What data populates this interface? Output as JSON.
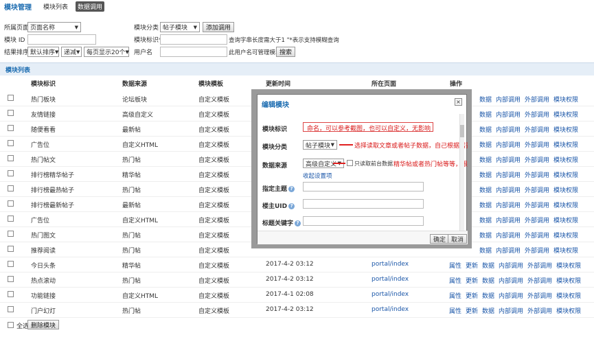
{
  "topbar": {
    "brand": "模块管理",
    "tabs": [
      "模块列表",
      "数据调用"
    ]
  },
  "filters": {
    "page_label": "所属页面",
    "page_value": "页面名称",
    "category_label": "模块分类",
    "category_value": "帖子模块",
    "add_call_button": "添加调用",
    "module_id_label": "模块 ID",
    "module_ident_label": "模块标识*",
    "ident_hint": "查询字串长度需大于1 \"*表示支持模糊查询",
    "sort_label": "结果排序",
    "sort_value": "默认排序",
    "order_value": "递减",
    "per_page_value": "每页显示20个",
    "username_label": "用户名",
    "username_hint": "此用户名可管理模块",
    "search_button": "搜索"
  },
  "list": {
    "title": "模块列表",
    "columns": [
      "模块标识",
      "数据来源",
      "模块模板",
      "更新时间",
      "所在页面",
      "操作"
    ],
    "ops_visible": [
      "数据",
      "内部调用",
      "外部调用",
      "模块权限"
    ],
    "ops_full": [
      "属性",
      "更新",
      "数据",
      "内部调用",
      "外部调用",
      "模块权限"
    ],
    "rows": [
      {
        "name": "热门板块",
        "source": "论坛板块",
        "template": "自定义模板",
        "time": "",
        "page": ""
      },
      {
        "name": "友情链接",
        "source": "高级自定义",
        "template": "自定义模板",
        "time": "",
        "page": ""
      },
      {
        "name": "随便看看",
        "source": "最新帖",
        "template": "自定义模板",
        "time": "",
        "page": ""
      },
      {
        "name": "广告位",
        "source": "自定义HTML",
        "template": "自定义模板",
        "time": "",
        "page": ""
      },
      {
        "name": "热门帖文",
        "source": "热门帖",
        "template": "自定义模板",
        "time": "",
        "page": ""
      },
      {
        "name": "排行榜精华帖子",
        "source": "精华帖",
        "template": "自定义模板",
        "time": "",
        "page": ""
      },
      {
        "name": "排行榜最热帖子",
        "source": "热门帖",
        "template": "自定义模板",
        "time": "",
        "page": ""
      },
      {
        "name": "排行榜最新帖子",
        "source": "最新帖",
        "template": "自定义模板",
        "time": "",
        "page": ""
      },
      {
        "name": "广告位",
        "source": "自定义HTML",
        "template": "自定义模板",
        "time": "",
        "page": ""
      },
      {
        "name": "热门图文",
        "source": "热门帖",
        "template": "自定义模板",
        "time": "",
        "page": ""
      },
      {
        "name": "推荐阅读",
        "source": "热门帖",
        "template": "自定义模板",
        "time": "",
        "page": ""
      },
      {
        "name": "今日头条",
        "source": "精华帖",
        "template": "自定义模板",
        "time": "2017-4-2 03:12",
        "page": "portal/index"
      },
      {
        "name": "热点滚动",
        "source": "热门帖",
        "template": "自定义模板",
        "time": "2017-4-2 03:12",
        "page": "portal/index"
      },
      {
        "name": "功能链接",
        "source": "自定义HTML",
        "template": "自定义模板",
        "time": "2017-4-1 02:08",
        "page": "portal/index"
      },
      {
        "name": "门户幻灯",
        "source": "热门帖",
        "template": "自定义模板",
        "time": "2017-4-2 03:12",
        "page": "portal/index"
      }
    ],
    "select_all": "全选",
    "delete_button": "删除模块"
  },
  "dialog": {
    "title": "编辑模块",
    "close": "×",
    "fields": {
      "ident_label": "模块标识",
      "ident_hint": "命名，可以参考截图，也可以自定义，无影响",
      "category_label": "模块分类",
      "category_value": "帖子模块",
      "category_hint": "选择读取文章或者帖子数据，自己根据需要自由切换",
      "source_label": "数据来源",
      "source_value": "高级自定义",
      "source_check_label": "只读取前台数据",
      "source_hint": "精华帖或者热门帖等等，根据自己需要选择",
      "collapse_link": "收起设置项",
      "theme_label": "指定主题",
      "uid_label": "楼主UID",
      "keyword_label": "标题关键字"
    },
    "ok_button": "确定",
    "cancel_button": "取消"
  }
}
